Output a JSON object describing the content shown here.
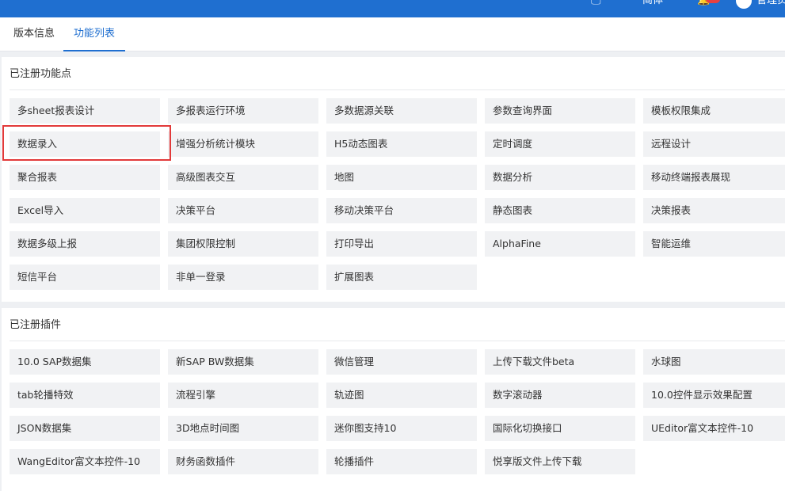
{
  "topbar": {
    "help_icon": "monitor-help-icon",
    "text": "简体",
    "bell_icon": "bell-icon",
    "avatar_icon": "user-avatar-icon",
    "user_label": "管理员"
  },
  "tabs": [
    {
      "label": "版本信息"
    },
    {
      "label": "功能列表"
    }
  ],
  "sections": [
    {
      "title": "已注册功能点",
      "items": [
        "多sheet报表设计",
        "多报表运行环境",
        "多数据源关联",
        "参数查询界面",
        "模板权限集成",
        "数据录入",
        "增强分析统计模块",
        "H5动态图表",
        "定时调度",
        "远程设计",
        "聚合报表",
        "高级图表交互",
        "地图",
        "数据分析",
        "移动终端报表展现",
        "Excel导入",
        "决策平台",
        "移动决策平台",
        "静态图表",
        "决策报表",
        "数据多级上报",
        "集团权限控制",
        "打印导出",
        "AlphaFine",
        "智能运维",
        "短信平台",
        "非单一登录",
        "扩展图表"
      ]
    },
    {
      "title": "已注册插件",
      "items": [
        "10.0 SAP数据集",
        "新SAP BW数据集",
        "微信管理",
        "上传下载文件beta",
        "水球图",
        "tab轮播特效",
        "流程引擎",
        "轨迹图",
        "数字滚动器",
        "10.0控件显示效果配置",
        "JSON数据集",
        "3D地点时间图",
        "迷你图支持10",
        "国际化切换接口",
        "UEditor富文本控件-10",
        "WangEditor富文本控件-10",
        "财务函数插件",
        "轮播插件",
        "悦享版文件上传下载"
      ]
    }
  ],
  "accent_color": "#1f6fd0",
  "highlight_color": "#e23a3a"
}
